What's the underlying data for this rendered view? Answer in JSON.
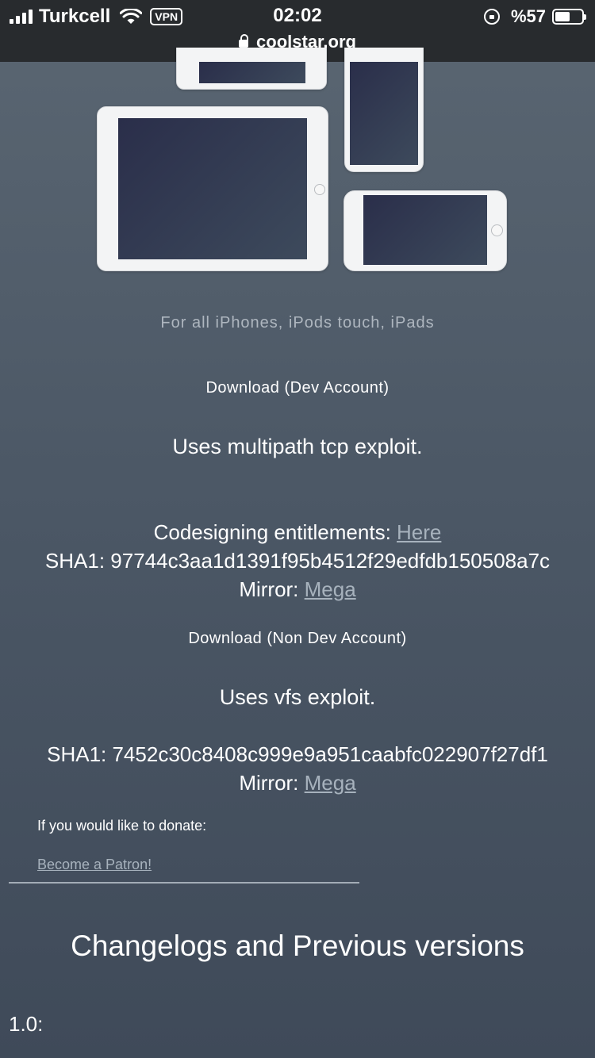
{
  "status_bar": {
    "carrier": "Turkcell",
    "vpn": "VPN",
    "time": "02:02",
    "battery": "%57",
    "battery_level": 0.57,
    "url": "coolstar.org"
  },
  "hero": {
    "caption": "For all iPhones, iPods touch, iPads"
  },
  "dev": {
    "download_label": "Download (Dev Account)",
    "exploit": "Uses multipath tcp exploit.",
    "entitlements_label": "Codesigning entitlements: ",
    "entitlements_link": "Here",
    "sha1": "SHA1: 97744c3aa1d1391f95b4512f29edfdb150508a7c",
    "mirror_label": "Mirror: ",
    "mirror_link": "Mega"
  },
  "nondev": {
    "download_label": "Download (Non Dev Account)",
    "exploit": "Uses vfs exploit.",
    "sha1": "SHA1: 7452c30c8408c999e9a951caabfc022907f27df1",
    "mirror_label": "Mirror: ",
    "mirror_link": "Mega"
  },
  "donate": {
    "text": "If you would like to donate:",
    "link": "Become a Patron!"
  },
  "changelog": {
    "heading": "Changelogs and Previous versions",
    "version": "1.0:"
  }
}
